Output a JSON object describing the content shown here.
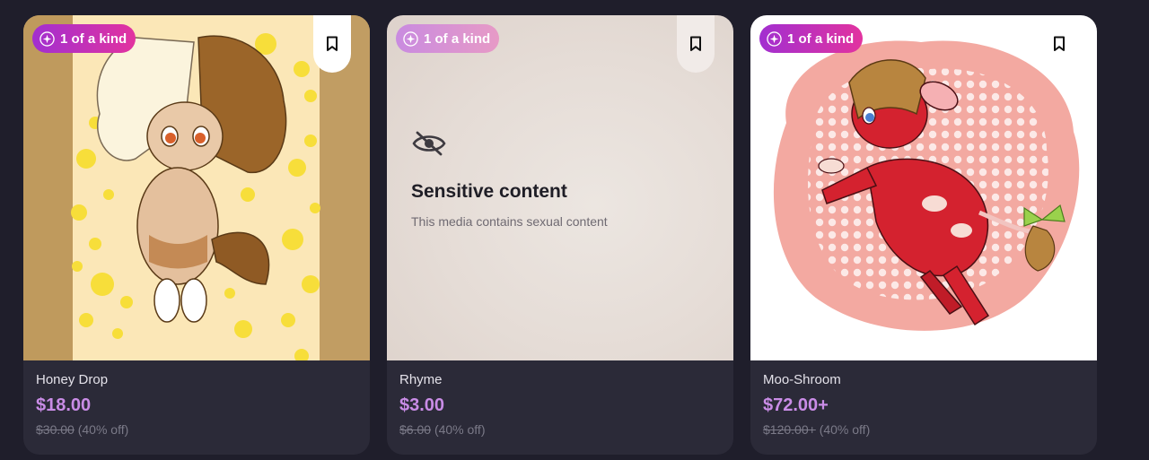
{
  "badge_label": "1 of a kind",
  "colors": {
    "page_bg": "#1f1e2b",
    "card_bg": "#2b2a38",
    "price": "#c98ce6",
    "badge_gradient_start": "#a22fd0",
    "badge_gradient_end": "#e2339f"
  },
  "cards": [
    {
      "title": "Honey Drop",
      "price": "$18.00",
      "original_price": "$30.00",
      "discount": "(40% off)",
      "image": "illustration of a cream and brown pony with bee theme on yellow polka-dot background"
    },
    {
      "title": "Rhyme",
      "price": "$3.00",
      "original_price": "$6.00",
      "discount": "(40% off)",
      "sensitive": {
        "icon": "eye-off-icon",
        "title": "Sensitive content",
        "subtitle": "This media contains sexual content"
      }
    },
    {
      "title": "Moo-Shroom",
      "price": "$72.00+",
      "original_price": "$120.00+",
      "discount": "(40% off)",
      "image": "illustration of a red cow-pony with white spots on pink dotted background"
    }
  ]
}
